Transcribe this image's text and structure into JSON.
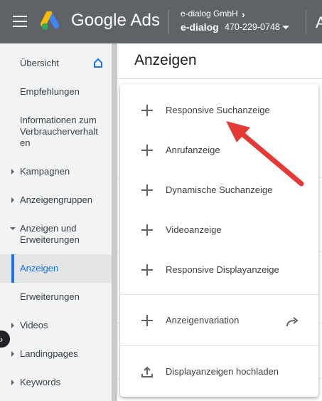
{
  "topbar": {
    "app_title": "Google Ads",
    "account_parent": "e-dialog GmbH",
    "account_name": "e-dialog",
    "account_id": "470-229-0748",
    "cut_text": "A"
  },
  "sidebar": {
    "items": [
      {
        "label": "Übersicht",
        "icon": "home-icon"
      },
      {
        "label": "Empfehlungen"
      },
      {
        "label": "Informationen zum Verbraucherverhalt en"
      },
      {
        "label": "Kampagnen",
        "expandable": true
      },
      {
        "label": "Anzeigengruppen",
        "expandable": true
      },
      {
        "label": "Anzeigen und Erweiterungen",
        "expanded": true
      },
      {
        "label": "Anzeigen",
        "active": true
      },
      {
        "label": "Erweiterungen"
      },
      {
        "label": "Videos",
        "expandable": true
      },
      {
        "label": "Landingpages",
        "expandable": true
      },
      {
        "label": "Keywords",
        "expandable": true
      }
    ],
    "collapse_glyph": "›"
  },
  "main": {
    "title": "Anzeigen"
  },
  "menu": {
    "items": [
      {
        "label": "Responsive Suchanzeige",
        "icon": "plus-icon"
      },
      {
        "label": "Anrufanzeige",
        "icon": "plus-icon"
      },
      {
        "label": "Dynamische Suchanzeige",
        "icon": "plus-icon"
      },
      {
        "label": "Videoanzeige",
        "icon": "plus-icon"
      },
      {
        "label": "Responsive Displayanzeige",
        "icon": "plus-icon"
      },
      {
        "label": "Anzeigenvariation",
        "icon": "plus-icon",
        "trailing_icon": "share-arrow-icon"
      },
      {
        "label": "Displayanzeigen hochladen",
        "icon": "upload-icon"
      }
    ]
  },
  "annotation": {
    "arrow_color": "#e53935"
  },
  "colors": {
    "topbar": "#5f6368",
    "accent": "#1a73e8",
    "sidebar_bg": "#f1f3f4"
  }
}
